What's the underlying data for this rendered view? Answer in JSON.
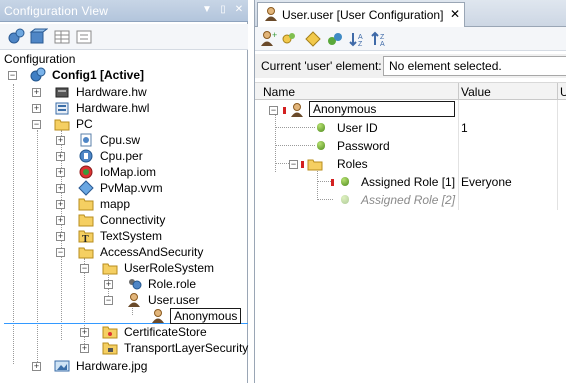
{
  "left_panel": {
    "title": "Configuration View",
    "config_label": "Configuration",
    "tree": [
      {
        "label": "Config1 [Active]",
        "bold": true
      },
      {
        "label": "Hardware.hw"
      },
      {
        "label": "Hardware.hwl"
      },
      {
        "label": "PC"
      },
      {
        "label": "Cpu.sw"
      },
      {
        "label": "Cpu.per"
      },
      {
        "label": "IoMap.iom"
      },
      {
        "label": "PvMap.vvm"
      },
      {
        "label": "mapp"
      },
      {
        "label": "Connectivity"
      },
      {
        "label": "TextSystem"
      },
      {
        "label": "AccessAndSecurity"
      },
      {
        "label": "UserRoleSystem"
      },
      {
        "label": "Role.role"
      },
      {
        "label": "User.user"
      },
      {
        "label": "Anonymous"
      },
      {
        "label": "CertificateStore"
      },
      {
        "label": "TransportLayerSecurity"
      },
      {
        "label": "Hardware.jpg"
      }
    ]
  },
  "right_panel": {
    "tab_title": "User.user [User Configuration]",
    "current_label": "Current 'user' element:",
    "current_value": "No element selected.",
    "columns": {
      "name": "Name",
      "value": "Value",
      "unit": "U"
    },
    "rows": [
      {
        "name": "Anonymous",
        "value": ""
      },
      {
        "name": "User ID",
        "value": "1"
      },
      {
        "name": "Password",
        "value": ""
      },
      {
        "name": "Roles",
        "value": ""
      },
      {
        "name": "Assigned Role [1]",
        "value": "Everyone"
      },
      {
        "name": "Assigned Role [2]",
        "value": ""
      }
    ]
  },
  "colors": {
    "accent": "#3399ff",
    "header_bg": "#b8c9de",
    "selection_border": "#1a1a1a"
  }
}
